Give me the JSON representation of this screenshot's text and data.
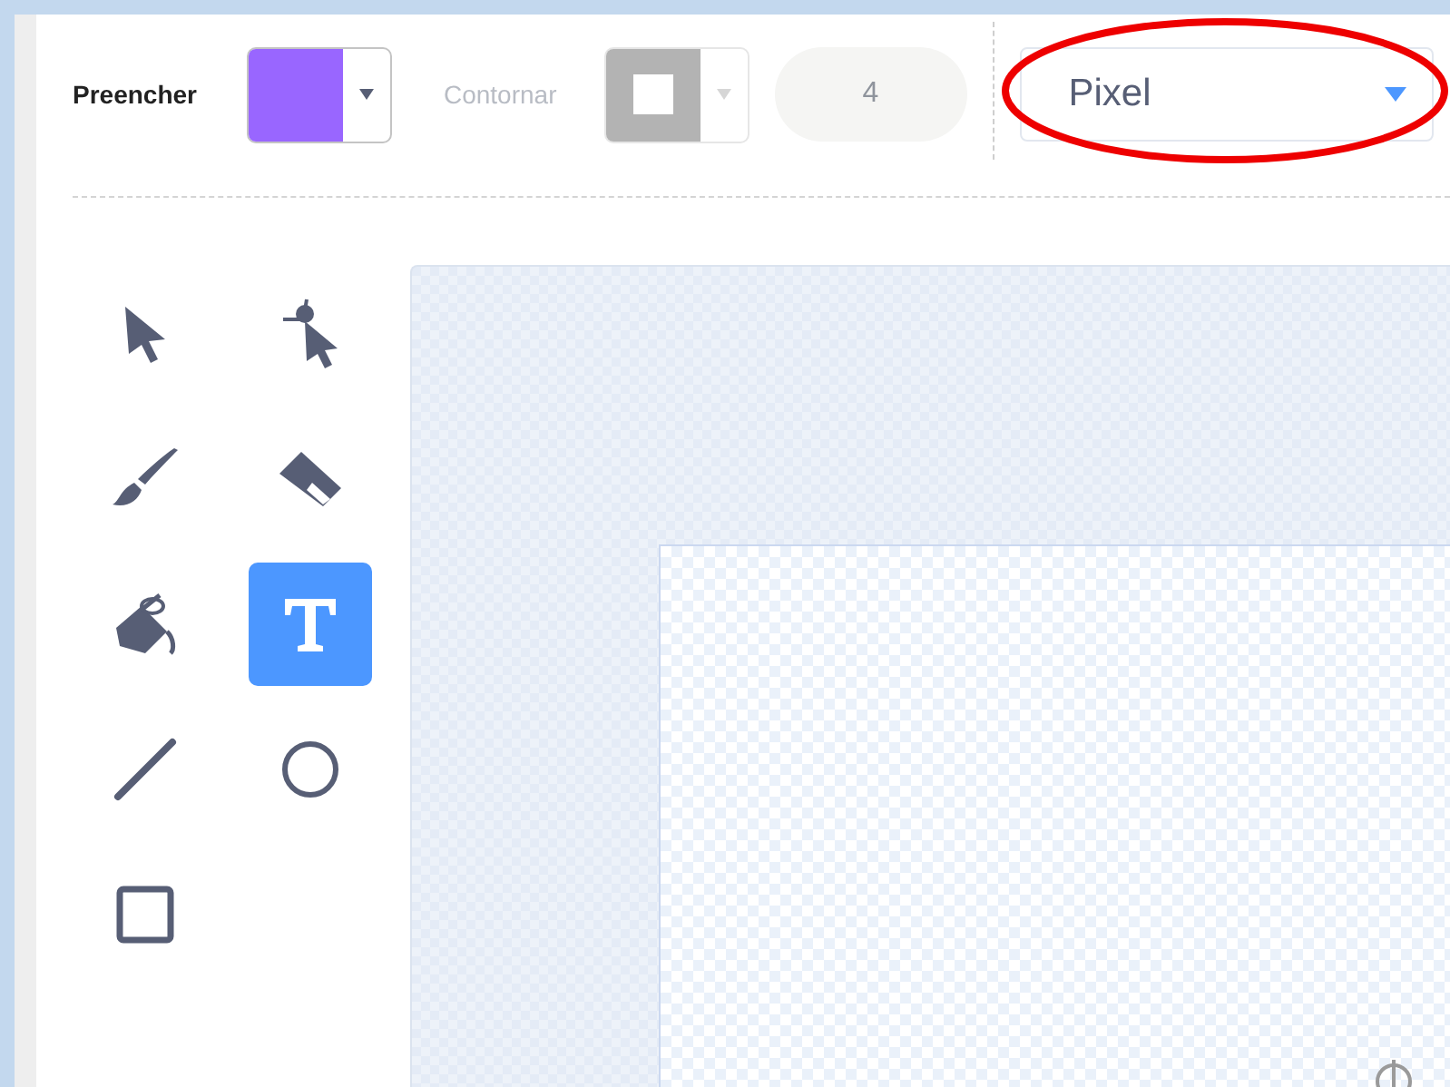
{
  "fill": {
    "label": "Preencher",
    "color": "#9966ff"
  },
  "outline": {
    "label": "Contornar",
    "disabled": true
  },
  "stroke_width": {
    "value": "4",
    "disabled": true
  },
  "mode_select": {
    "value": "Pixel"
  },
  "tools": [
    {
      "kind": "select",
      "selected": false
    },
    {
      "kind": "reshape",
      "selected": false
    },
    {
      "kind": "brush",
      "selected": false
    },
    {
      "kind": "eraser",
      "selected": false
    },
    {
      "kind": "fill",
      "selected": false
    },
    {
      "kind": "text",
      "selected": true
    },
    {
      "kind": "line",
      "selected": false
    },
    {
      "kind": "circle",
      "selected": false
    },
    {
      "kind": "rect",
      "selected": false
    }
  ],
  "annotation": {
    "kind": "ellipse"
  }
}
